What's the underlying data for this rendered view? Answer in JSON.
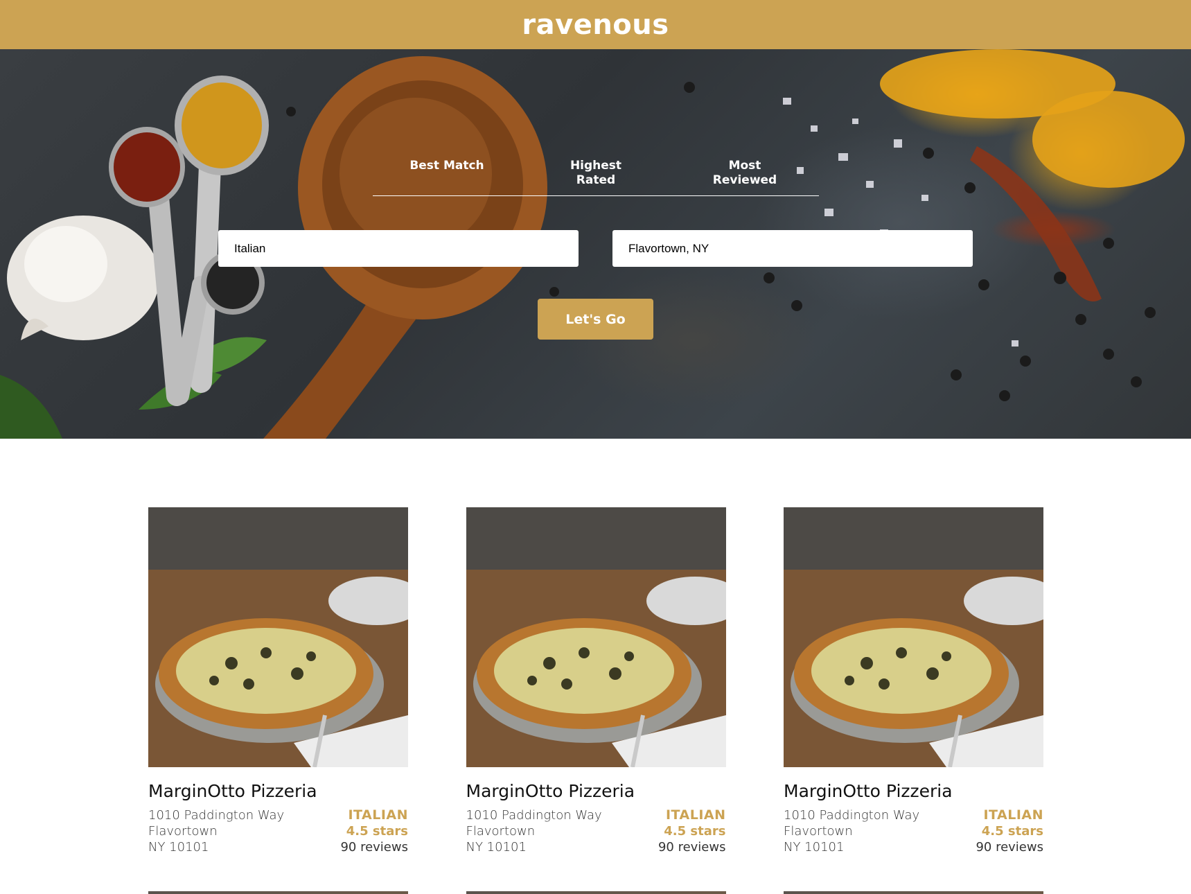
{
  "header": {
    "logo": "ravenous"
  },
  "hero": {
    "sort_tabs": [
      {
        "label": "Best Match"
      },
      {
        "label": "Highest Rated"
      },
      {
        "label": "Most Reviewed"
      }
    ],
    "search": {
      "term_value": "Italian",
      "location_value": "Flavortown, NY"
    },
    "go_button_label": "Let's Go"
  },
  "businesses": [
    {
      "name": "MarginOtto Pizzeria",
      "address": "1010 Paddington Way",
      "city": "Flavortown",
      "state_zip": "NY 10101",
      "category": "ITALIAN",
      "rating": "4.5 stars",
      "review_count": "90 reviews"
    },
    {
      "name": "MarginOtto Pizzeria",
      "address": "1010 Paddington Way",
      "city": "Flavortown",
      "state_zip": "NY 10101",
      "category": "ITALIAN",
      "rating": "4.5 stars",
      "review_count": "90 reviews"
    },
    {
      "name": "MarginOtto Pizzeria",
      "address": "1010 Paddington Way",
      "city": "Flavortown",
      "state_zip": "NY 10101",
      "category": "ITALIAN",
      "rating": "4.5 stars",
      "review_count": "90 reviews"
    }
  ],
  "colors": {
    "brand_gold": "#cca353",
    "hero_slate": "#33373b",
    "text_dark": "#111111"
  }
}
